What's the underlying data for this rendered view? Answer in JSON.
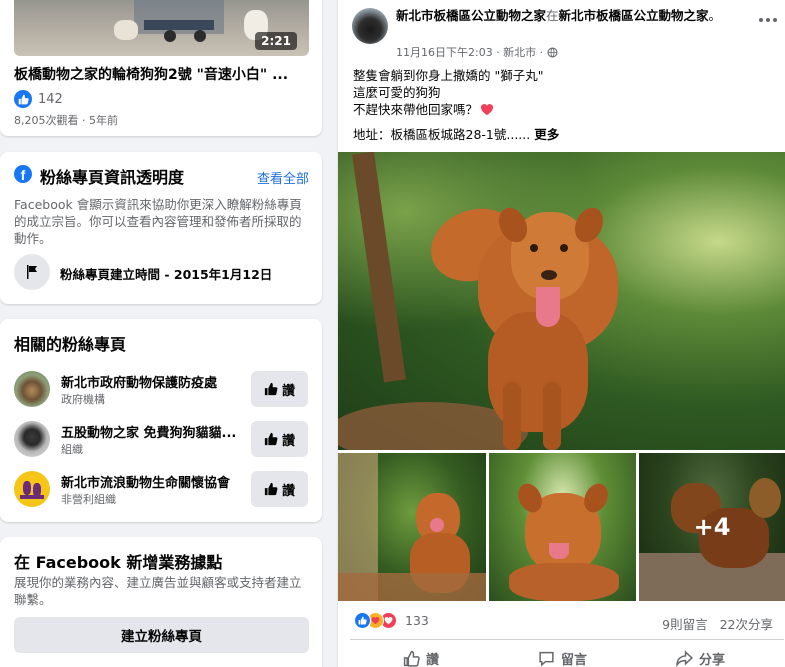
{
  "video_card": {
    "duration": "2:21",
    "title": "板橋動物之家的輪椅狗狗2號 \"音速小白\" ...",
    "like_count": "142",
    "meta": "8,205次觀看 · 5年前"
  },
  "transparency": {
    "heading": "粉絲專頁資訊透明度",
    "see_all": "查看全部",
    "description": "Facebook 會顯示資訊來協助你更深入瞭解粉絲專頁的成立宗旨。你可以查看內容管理和發佈者所採取的動作。",
    "created": "粉絲專頁建立時間 - 2015年1月12日"
  },
  "related": {
    "heading": "相關的粉絲專頁",
    "like_label": "讚",
    "pages": [
      {
        "name": "新北市政府動物保護防疫處",
        "category": "政府機構"
      },
      {
        "name": "五股動物之家 免費狗狗貓貓...",
        "category": "組織"
      },
      {
        "name": "新北市流浪動物生命關懷協會",
        "category": "非營利組織"
      }
    ]
  },
  "business": {
    "heading": "在 Facebook 新增業務據點",
    "description": "展現你的業務內容、建立廣告並與顧客或支持者建立聯繫。",
    "button": "建立粉絲專頁"
  },
  "post": {
    "author": "新北市板橋區公立動物之家",
    "connector": "在",
    "location_page": "新北市板橋區公立動物之家",
    "trailing": "。",
    "time": "11月16日下午2:03 · 新北市 ·",
    "more_icon": "ellipsis-icon",
    "lines": [
      "整隻會躺到你身上撒嬌的 \"獅子丸\"",
      "這麼可愛的狗狗",
      "不趕快來帶他回家嗎？"
    ],
    "address": "地址：板橋區板城路28-1號......",
    "see_more": "更多",
    "more_photos": "+4",
    "reaction_count": "133",
    "comments": "9則留言",
    "shares": "22次分享",
    "actions": {
      "like": "讚",
      "comment": "留言",
      "share": "分享"
    }
  },
  "colors": {
    "accent": "#216fdb",
    "facebook_blue": "#1877f2",
    "heart": "#f33e58"
  }
}
